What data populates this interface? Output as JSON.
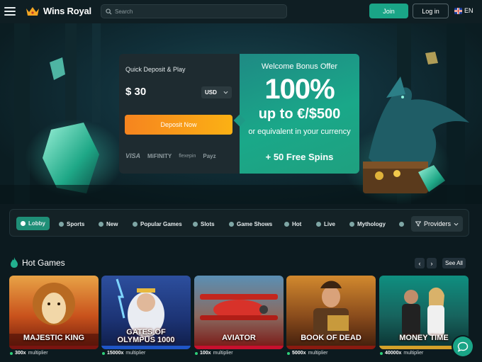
{
  "header": {
    "brand": "Wins Royal",
    "search_placeholder": "Search",
    "join_label": "Join",
    "login_label": "Log in",
    "language": "EN"
  },
  "deposit": {
    "title": "Quick Deposit & Play",
    "amount": "$ 30",
    "currency": "USD",
    "button_label": "Deposit Now",
    "payment_methods": [
      "VISA",
      "MiFINITY",
      "flexepin",
      "Payz"
    ]
  },
  "bonus": {
    "title": "Welcome Bonus Offer",
    "percent": "100%",
    "up_to": "up to €/$500",
    "equivalent": "or equivalent in your currency",
    "free_spins": "+ 50 Free Spins"
  },
  "categories": [
    {
      "label": "Lobby",
      "icon": "lobby-icon",
      "active": true
    },
    {
      "label": "Sports",
      "icon": "sports-icon",
      "active": false
    },
    {
      "label": "New",
      "icon": "new-icon",
      "active": false
    },
    {
      "label": "Popular Games",
      "icon": "star-icon",
      "active": false
    },
    {
      "label": "Slots",
      "icon": "slots-icon",
      "active": false
    },
    {
      "label": "Game Shows",
      "icon": "game-shows-icon",
      "active": false
    },
    {
      "label": "Hot",
      "icon": "flame-icon",
      "active": false
    },
    {
      "label": "Live",
      "icon": "live-icon",
      "active": false
    },
    {
      "label": "Mythology",
      "icon": "mythology-icon",
      "active": false
    }
  ],
  "providers_label": "Providers",
  "hot_games": {
    "title": "Hot Games",
    "prev": "‹",
    "next": "›",
    "see_all": "See All",
    "games": [
      {
        "name": "MAJESTIC KING",
        "multiplier": "300x",
        "multiplier_label": "multiplier"
      },
      {
        "name": "GATES OF OLYMPUS 1000",
        "name_line1": "GATES OF",
        "name_line2": "OLYMPUS 1000",
        "multiplier": "15000x",
        "multiplier_label": "multiplier"
      },
      {
        "name": "AVIATOR",
        "multiplier": "100x",
        "multiplier_label": "multiplier"
      },
      {
        "name": "BOOK OF DEAD",
        "multiplier": "5000x",
        "multiplier_label": "multiplier"
      },
      {
        "name": "MONEY TIME",
        "multiplier": "40000x",
        "multiplier_label": "multiplier"
      }
    ]
  },
  "colors": {
    "accent": "#1aa587",
    "deposit_button": "#f6841f",
    "background": "#0c1a1f"
  }
}
